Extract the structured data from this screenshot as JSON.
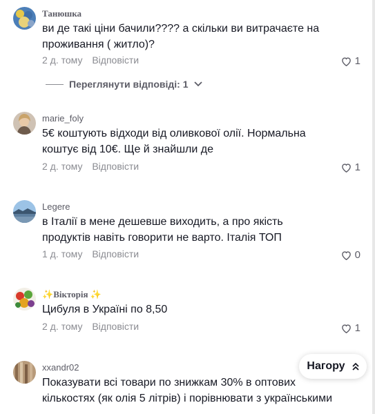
{
  "comments": [
    {
      "username": "Танюшка",
      "text": "ви де такі ціни бачили???? а скільки ви витрачаєте на проживання ( житло)?",
      "time": "2 д. тому",
      "reply": "Відповісти",
      "likes": "1"
    },
    {
      "username": "marie_foly",
      "text": "5€ коштують відходи від оливкової олії. Нормальна коштує від 10€. Ще й знайшли де",
      "time": "2 д. тому",
      "reply": "Відповісти",
      "likes": "1"
    },
    {
      "username": "Legere",
      "text": "в Італії в мене дешевше виходить, а про якість продуктів навіть говорити не варто. Італія ТОП",
      "time": "1 д. тому",
      "reply": "Відповісти",
      "likes": "0"
    },
    {
      "username": "Вікторія",
      "username_prefix": "✨",
      "username_suffix": "✨",
      "text": "Цибуля в Україні по 8,50",
      "time": "2 д. тому",
      "reply": "Відповісти",
      "likes": "1"
    },
    {
      "username": "xxandr02",
      "text": "Показувати всі товари по знижкам 30% в оптових кількостях (як олія 5 літрів) і порівнювати з українськими",
      "time": "",
      "reply": "",
      "likes": ""
    }
  ],
  "view_replies": "Переглянути відповіді: 1",
  "top_button": {
    "label": "Нагору",
    "icon": "double-chevron-up-icon"
  },
  "colors": {
    "text": "#161823",
    "muted": "#8a8b91",
    "username": "#5c5c66"
  }
}
